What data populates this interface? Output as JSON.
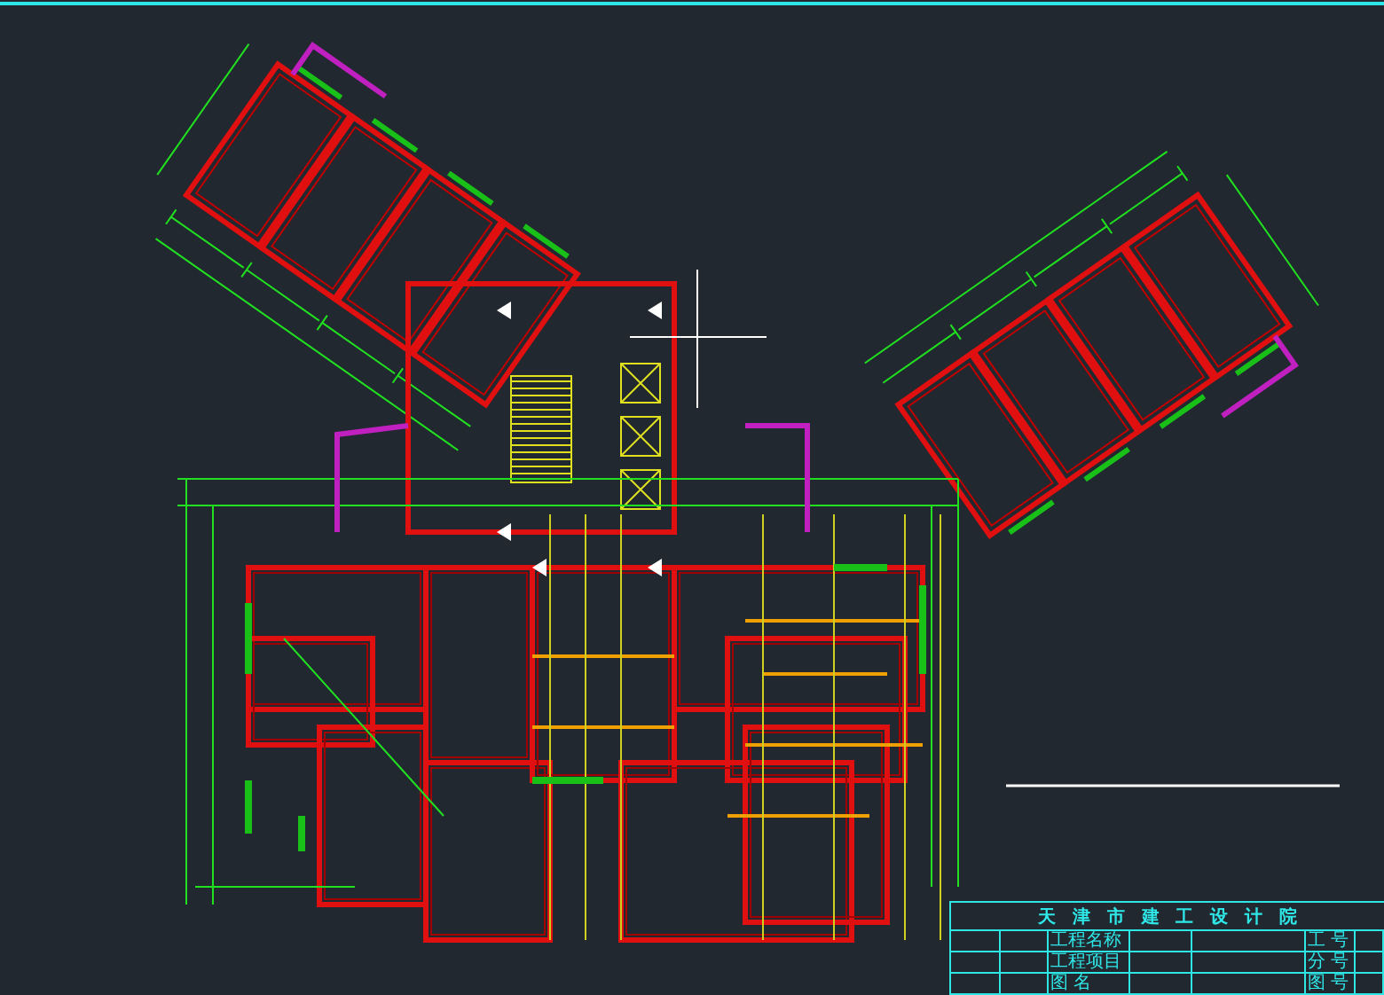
{
  "title_block": {
    "title": "天 津 市 建 工 设 计 院",
    "middle_labels": [
      "工程名称",
      "工程项目",
      "图 名"
    ],
    "right_labels": [
      "工 号",
      "分 号",
      "图 号"
    ]
  }
}
